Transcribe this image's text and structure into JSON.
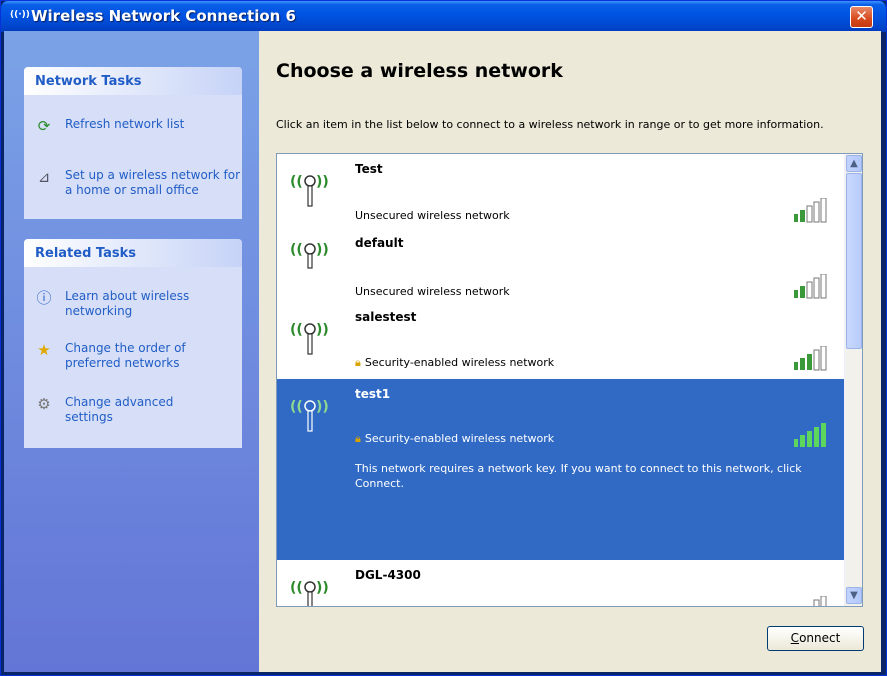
{
  "window": {
    "title": "Wireless Network Connection 6",
    "title_icon": "(( ))"
  },
  "sidebar": {
    "network_tasks": {
      "header": "Network Tasks",
      "items": [
        {
          "label": "Refresh network list",
          "icon": "refresh-icon"
        },
        {
          "label": "Set up a wireless network for a home or small office",
          "icon": "wireless-setup-icon"
        }
      ]
    },
    "related_tasks": {
      "header": "Related Tasks",
      "items": [
        {
          "label": "Learn about wireless networking",
          "icon": "info-icon"
        },
        {
          "label": "Change the order of preferred networks",
          "icon": "star-icon"
        },
        {
          "label": "Change advanced settings",
          "icon": "settings-icon"
        }
      ]
    }
  },
  "main": {
    "heading": "Choose a wireless network",
    "intro": "Click an item in the list below to connect to a wireless network in range or to get more information.",
    "networks": [
      {
        "name": "Test",
        "security": "Unsecured wireless network",
        "secured": false,
        "signal_bars": 2
      },
      {
        "name": "default",
        "security": "Unsecured wireless network",
        "secured": false,
        "signal_bars": 2
      },
      {
        "name": "salestest",
        "security": "Security-enabled wireless network",
        "secured": true,
        "signal_bars": 3
      },
      {
        "name": "test1",
        "security": "Security-enabled wireless network",
        "secured": true,
        "signal_bars": 5,
        "selected": true,
        "description": "This network requires a network key. If you want to connect to this network, click Connect."
      },
      {
        "name": "DGL-4300",
        "security": "",
        "secured": false,
        "signal_bars": 1
      }
    ],
    "connect_label": "Connect",
    "connect_accel": "C"
  },
  "colors": {
    "title_bar": "#0054e3",
    "selection": "#316ac5",
    "task_link": "#215dc6",
    "panel_bg": "#d6dff7"
  }
}
